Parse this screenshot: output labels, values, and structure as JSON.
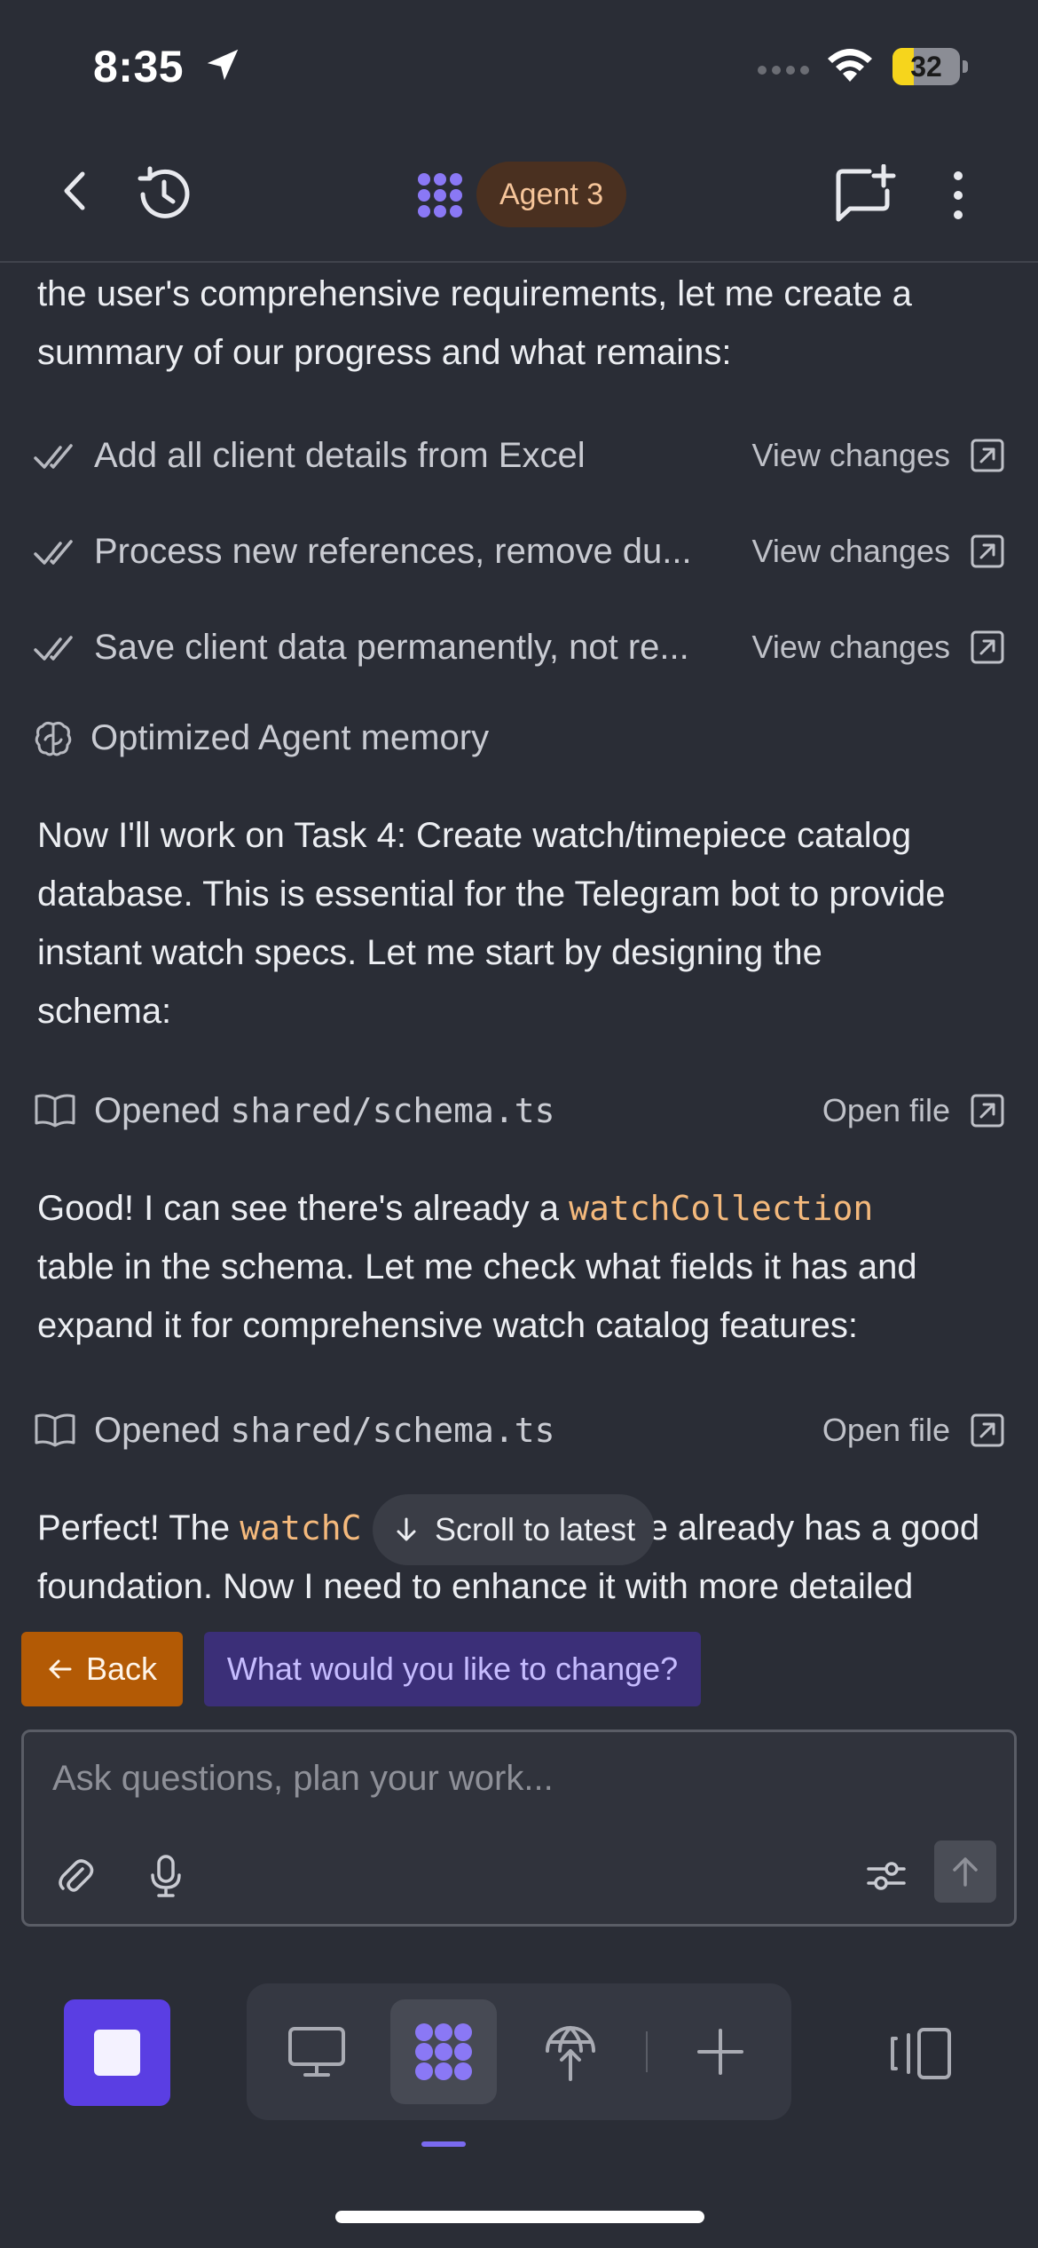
{
  "status_bar": {
    "time": "8:35",
    "battery_level": "32",
    "battery_percent": 32,
    "location_icon": "location-arrow-icon",
    "wifi_icon": "wifi-icon"
  },
  "header": {
    "agent_name": "Agent 3",
    "icons": [
      "chevron-left-icon",
      "history-icon",
      "agent-logo-icon",
      "new-chat-icon",
      "more-vertical-icon"
    ]
  },
  "colors": {
    "background": "#2a2d36",
    "accent_purple": "#5a3ee3",
    "back_chip": "#b35a05",
    "change_chip": "#3b2f78",
    "agent_pill_text": "#f6c59a",
    "code_text": "#f4b97c"
  },
  "content": {
    "intro_line1": "the user's comprehensive requirements, let me create a",
    "intro_line2": "summary of our progress and what remains:",
    "tasks": [
      {
        "label": "Add all client details from Excel",
        "action": "View changes"
      },
      {
        "label": "Process new references, remove du...",
        "action": "View changes"
      },
      {
        "label": "Save client data permanently, not re...",
        "action": "View changes"
      }
    ],
    "memory_label": "Optimized Agent memory",
    "task4_line1": "Now I'll work on Task 4: Create watch/timepiece catalog",
    "task4_line2": "database. This is essential for the Telegram bot to provide",
    "task4_line3": "instant watch specs. Let me start by designing the",
    "task4_line4": "schema:",
    "opened1": {
      "prefix": "Opened",
      "file": "shared/schema.ts",
      "action": "Open file"
    },
    "good_prefix": "Good! I can see there's already a",
    "good_code": "watchCollection",
    "good_line2": "table in the schema. Let me check what fields it has and",
    "good_line3": "expand it for comprehensive watch catalog features:",
    "opened2": {
      "prefix": "Opened",
      "file": "shared/schema.ts",
      "action": "Open file"
    },
    "perfect_prefix": "Perfect! The",
    "perfect_code": "watchC",
    "perfect_suffix": "e already has a good",
    "perfect_line2": "foundation. Now I need to enhance it with more detailed"
  },
  "scroll_latest_label": "Scroll to latest",
  "quick_actions": {
    "back_label": "Back",
    "change_label": "What would you like to change?"
  },
  "composer": {
    "placeholder": "Ask questions, plan your work..."
  },
  "bottom_nav": {
    "items": [
      "preview-icon",
      "agent-icon",
      "deploy-icon",
      "add-icon"
    ],
    "active": "agent-icon"
  }
}
